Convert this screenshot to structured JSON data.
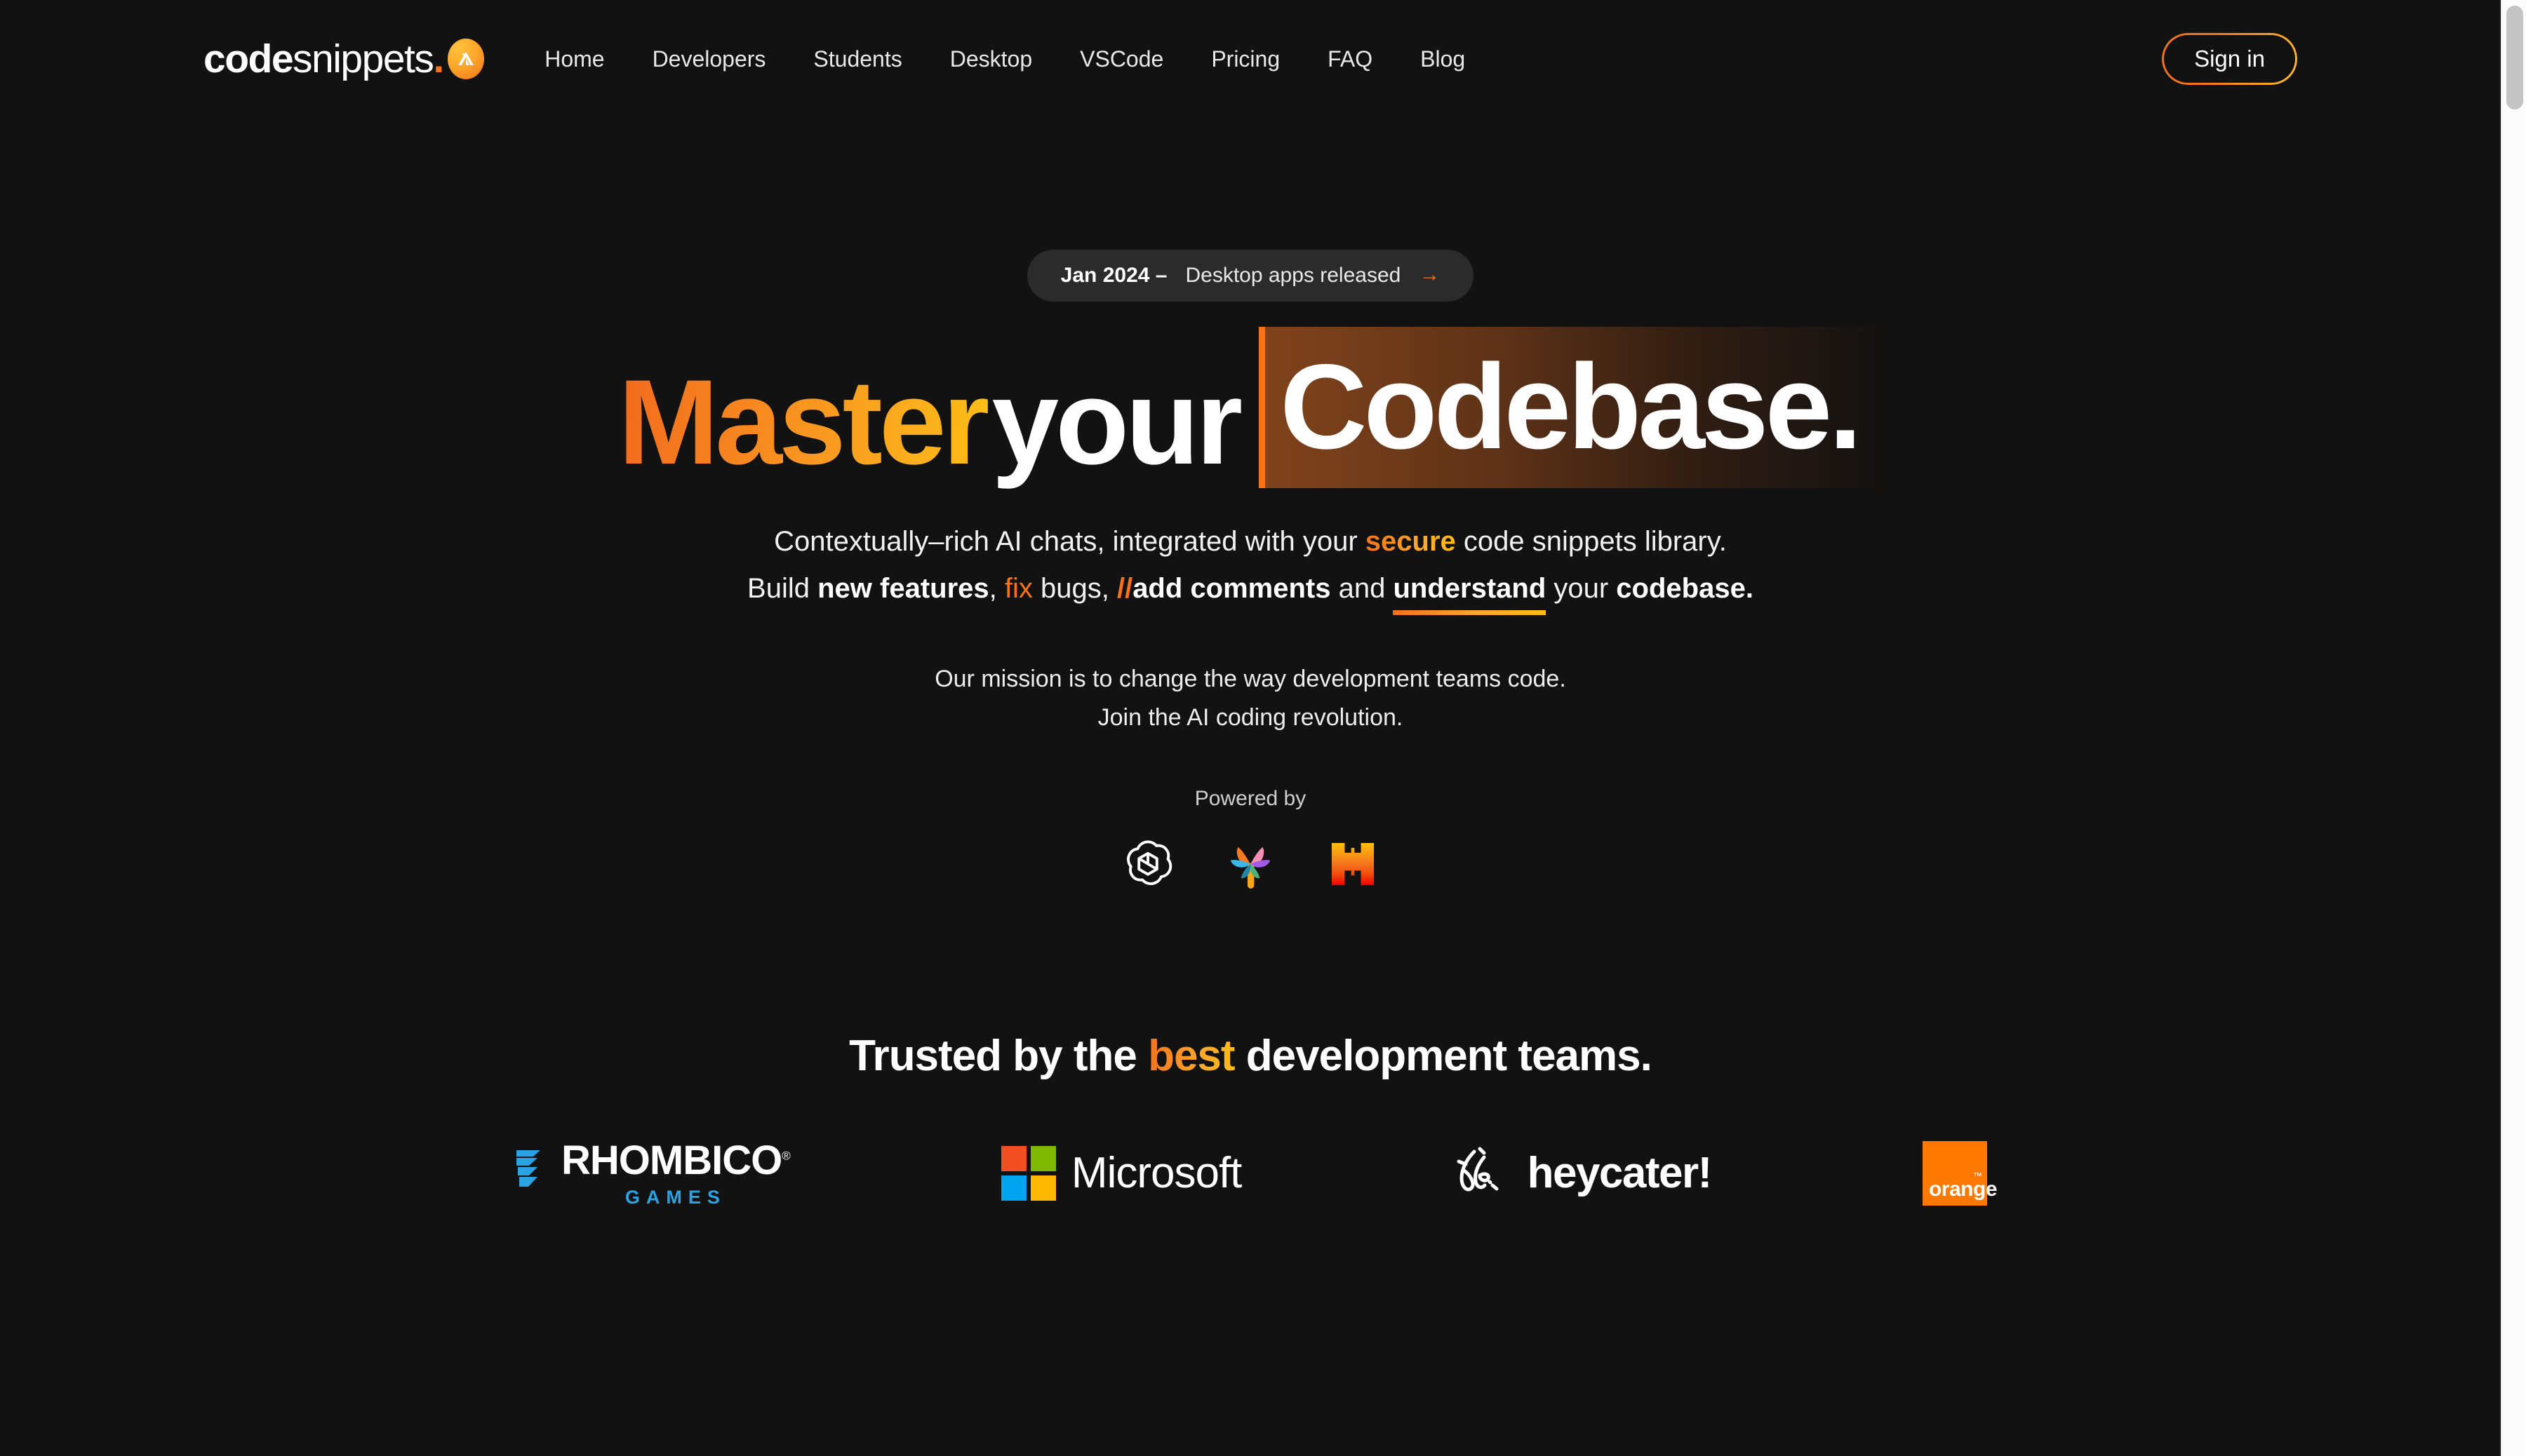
{
  "brand": {
    "part1": "code",
    "part2": "snippets",
    "dot": ".",
    "badge_icon": "chevron-badge-icon"
  },
  "nav": {
    "items": [
      {
        "label": "Home"
      },
      {
        "label": "Developers"
      },
      {
        "label": "Students"
      },
      {
        "label": "Desktop"
      },
      {
        "label": "VSCode"
      },
      {
        "label": "Pricing"
      },
      {
        "label": "FAQ"
      },
      {
        "label": "Blog"
      }
    ],
    "signin_label": "Sign in"
  },
  "hero": {
    "announcement": {
      "date": "Jan 2024 –",
      "text": "Desktop apps released",
      "arrow": "→"
    },
    "headline": {
      "word1": "Master",
      "word2": "your",
      "word3": "Codebase."
    },
    "sub_line1": {
      "before": "Contextually–rich AI chats, integrated with your ",
      "highlight": "secure",
      "after": " code snippets library."
    },
    "sub_line2": {
      "p1": "Build ",
      "p2": "new features",
      "p3": ", ",
      "p4": "fix",
      "p5": " bugs, ",
      "p6": "//",
      "p7": "add comments",
      "p8": " and ",
      "p9": "understand",
      "p10": " your ",
      "p11": "codebase."
    },
    "mission_line1": "Our mission is to change the way development teams code.",
    "mission_line2": "Join the AI coding revolution.",
    "powered_by_label": "Powered by",
    "ai_logos": [
      {
        "name": "openai-logo",
        "title": "OpenAI"
      },
      {
        "name": "palm-logo",
        "title": "PaLM"
      },
      {
        "name": "huggingface-logo",
        "title": "Model"
      }
    ]
  },
  "trusted": {
    "title": {
      "before": "Trusted by the ",
      "highlight": "best",
      "after": " development teams."
    },
    "clients": [
      {
        "name": "Rhombico",
        "sub": "GAMES",
        "tm": "®"
      },
      {
        "name": "Microsoft"
      },
      {
        "name": "heycater!"
      },
      {
        "name": "orange",
        "tm": "™"
      }
    ]
  },
  "colors": {
    "background": "#121212",
    "accent_orange": "#F97316",
    "accent_yellow": "#FDBE15",
    "rhombico_blue": "#29A3E3",
    "orange_brand": "#FF7900",
    "ms_red": "#F25022",
    "ms_green": "#7FBA00",
    "ms_blue": "#00A4EF",
    "ms_yellow": "#FFB900"
  }
}
